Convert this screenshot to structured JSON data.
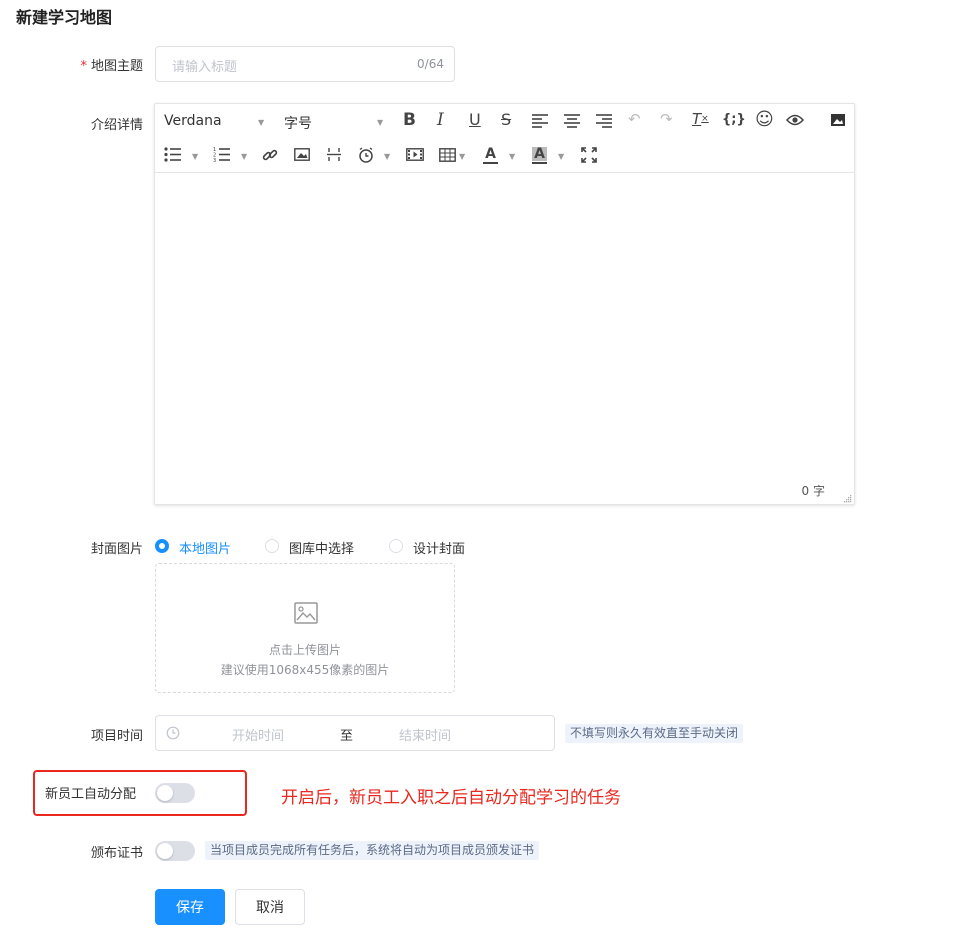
{
  "page": {
    "title": "新建学习地图"
  },
  "topic": {
    "label": "地图主题",
    "required_mark": "*",
    "placeholder": "请输入标题",
    "counter": "0/64"
  },
  "intro": {
    "label": "介绍详情",
    "toolbar": {
      "font_family": "Verdana",
      "font_size": "字号",
      "row1_icons": [
        "bold-icon",
        "italic-icon",
        "underline-icon",
        "strikethrough-icon",
        "align-left-icon",
        "align-center-icon",
        "align-right-icon",
        "undo-icon",
        "redo-icon",
        "clear-format-icon",
        "code-icon",
        "emoji-icon",
        "preview-icon",
        "image-icon"
      ],
      "row2_icons": [
        "bullet-list-icon",
        "numbered-list-icon",
        "link-icon",
        "insert-image-icon",
        "horizontal-rule-icon",
        "time-icon",
        "video-icon",
        "table-icon",
        "font-color-icon",
        "background-color-icon",
        "fullscreen-icon"
      ]
    },
    "word_count": "0 字"
  },
  "cover": {
    "label": "封面图片",
    "options": [
      "本地图片",
      "图库中选择",
      "设计封面"
    ],
    "selected": "本地图片",
    "upload_title": "点击上传图片",
    "upload_hint": "建议使用1068x455像素的图片"
  },
  "project_time": {
    "label": "项目时间",
    "start_placeholder": "开始时间",
    "separator": "至",
    "end_placeholder": "结束时间",
    "tip": "不填写则永久有效直至手动关闭"
  },
  "auto_assign": {
    "label": "新员工自动分配",
    "enabled": false,
    "annotation": "开启后，新员工入职之后自动分配学习的任务",
    "annotation_color": "#e8281f"
  },
  "certificate": {
    "label": "颁布证书",
    "enabled": false,
    "tip": "当项目成员完成所有任务后，系统将自动为项目成员颁发证书"
  },
  "actions": {
    "save": "保存",
    "cancel": "取消"
  },
  "colors": {
    "primary": "#1890ff",
    "annotation": "#e8281f"
  }
}
